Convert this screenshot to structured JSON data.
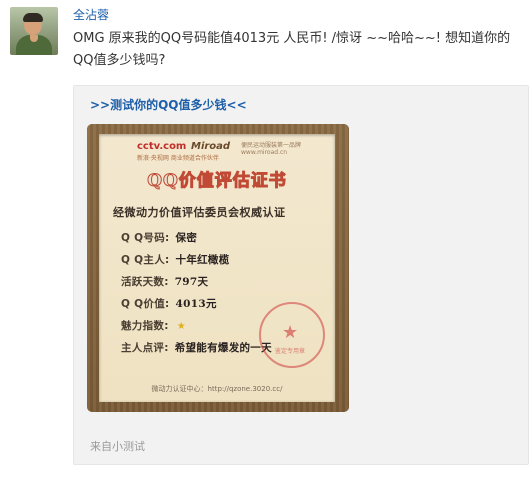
{
  "post": {
    "username": "全沾蓉",
    "text": "OMG 原来我的QQ号码能值4013元 人民币! /惊讶 ~~哈哈~~! 想知道你的QQ值多少钱吗?"
  },
  "card": {
    "link_text": ">>测试你的QQ值多少钱<<",
    "source_label": "来自小测试"
  },
  "certificate": {
    "logo_cctv": "cctv.com",
    "logo_miroad": "Miroad",
    "logo_tagline": "便民运动服装第一品牌 www.miroad.cn",
    "logo_subtext": "新浪·央视网 商业频道合作伙伴",
    "title": "QQ价值评估证书",
    "subtitle": "经微动力价值评估委员会权威认证",
    "fields": [
      {
        "label": "Q Q号码:",
        "value": "保密"
      },
      {
        "label": "Q Q主人:",
        "value": "十年红橄榄"
      },
      {
        "label": "活跃天数:",
        "value": "797天"
      },
      {
        "label": "Q Q价值:",
        "value": "4013元"
      },
      {
        "label": "魅力指数:",
        "value": "★"
      },
      {
        "label": "主人点评:",
        "value": "希望能有爆发的一天"
      }
    ],
    "stamp_text": "鉴定专用章",
    "footer_url": "微动力认证中心：http://qzone.3020.cc/"
  }
}
